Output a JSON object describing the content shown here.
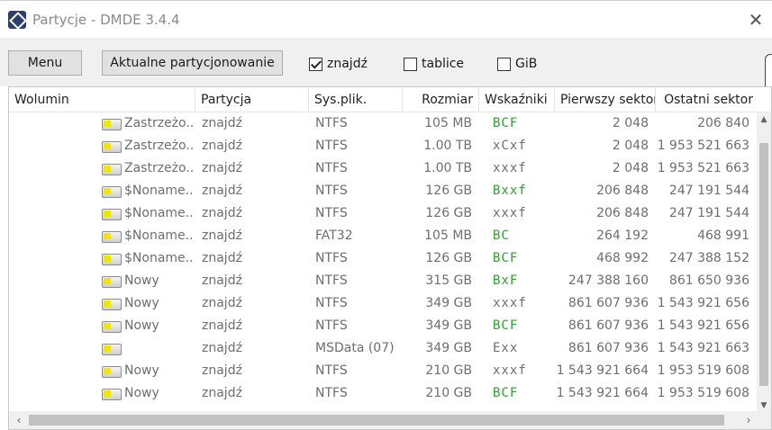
{
  "window": {
    "title": "Partycje - DMDE 3.4.4",
    "close_glyph": "✕"
  },
  "toolbar": {
    "menu_label": "Menu",
    "current_partitioning_label": "Aktualne partycjonowanie",
    "checkboxes": [
      {
        "label": "znajdź",
        "checked": true
      },
      {
        "label": "tablice",
        "checked": false
      },
      {
        "label": "GiB",
        "checked": false
      }
    ]
  },
  "table": {
    "columns": [
      "Wolumin",
      "Partycja",
      "Sys.plik.",
      "Rozmiar",
      "Wskaźniki",
      "Pierwszy sektor",
      "Ostatni sektor"
    ],
    "rows": [
      {
        "volume": "Zastrzeżo...",
        "partition": "znajdź",
        "fs": "NTFS",
        "size": "105 MB",
        "flags": "BCF",
        "flags_color": "#2ea12e",
        "first": "2 048",
        "last": "206 840"
      },
      {
        "volume": "Zastrzeżo...",
        "partition": "znajdź",
        "fs": "NTFS",
        "size": "1.00 TB",
        "flags": "xCxf",
        "flags_color": "#6e6e6e",
        "first": "2 048",
        "last": "1 953 521 663"
      },
      {
        "volume": "Zastrzeżo...",
        "partition": "znajdź",
        "fs": "NTFS",
        "size": "1.00 TB",
        "flags": "xxxf",
        "flags_color": "#6e6e6e",
        "first": "2 048",
        "last": "1 953 521 663"
      },
      {
        "volume": "$Noname...",
        "partition": "znajdź",
        "fs": "NTFS",
        "size": "126 GB",
        "flags": "Bxxf",
        "flags_color": "#2ea12e",
        "first": "206 848",
        "last": "247 191 544"
      },
      {
        "volume": "$Noname...",
        "partition": "znajdź",
        "fs": "NTFS",
        "size": "126 GB",
        "flags": "xxxf",
        "flags_color": "#6e6e6e",
        "first": "206 848",
        "last": "247 191 544"
      },
      {
        "volume": "$Noname...",
        "partition": "znajdź",
        "fs": "FAT32",
        "size": "105 MB",
        "flags": "BC",
        "flags_color": "#2ea12e",
        "first": "264 192",
        "last": "468 991"
      },
      {
        "volume": "$Noname...",
        "partition": "znajdź",
        "fs": "NTFS",
        "size": "126 GB",
        "flags": "BCF",
        "flags_color": "#2ea12e",
        "first": "468 992",
        "last": "247 388 152"
      },
      {
        "volume": "Nowy",
        "partition": "znajdź",
        "fs": "NTFS",
        "size": "315 GB",
        "flags": "BxF",
        "flags_color": "#2ea12e",
        "first": "247 388 160",
        "last": "861 650 936"
      },
      {
        "volume": "Nowy",
        "partition": "znajdź",
        "fs": "NTFS",
        "size": "349 GB",
        "flags": "xxxf",
        "flags_color": "#6e6e6e",
        "first": "861 607 936",
        "last": "1 543 921 656"
      },
      {
        "volume": "Nowy",
        "partition": "znajdź",
        "fs": "NTFS",
        "size": "349 GB",
        "flags": "BCF",
        "flags_color": "#2ea12e",
        "first": "861 607 936",
        "last": "1 543 921 656"
      },
      {
        "volume": "",
        "partition": "znajdź",
        "fs": "MSData (07)",
        "size": "349 GB",
        "flags": "Exx",
        "flags_color": "#6e6e6e",
        "first": "861 607 936",
        "last": "1 543 921 663"
      },
      {
        "volume": "Nowy",
        "partition": "znajdź",
        "fs": "NTFS",
        "size": "210 GB",
        "flags": "xxxf",
        "flags_color": "#6e6e6e",
        "first": "1 543 921 664",
        "last": "1 953 519 608"
      },
      {
        "volume": "Nowy",
        "partition": "znajdź",
        "fs": "NTFS",
        "size": "210 GB",
        "flags": "BCF",
        "flags_color": "#2ea12e",
        "first": "1 543 921 664",
        "last": "1 953 519 608"
      }
    ]
  },
  "scrollbars": {
    "up": "▲",
    "down": "▼",
    "left": "‹",
    "right": "›"
  },
  "icons": {
    "app": "dmde-app-icon",
    "drive": "drive-icon"
  }
}
